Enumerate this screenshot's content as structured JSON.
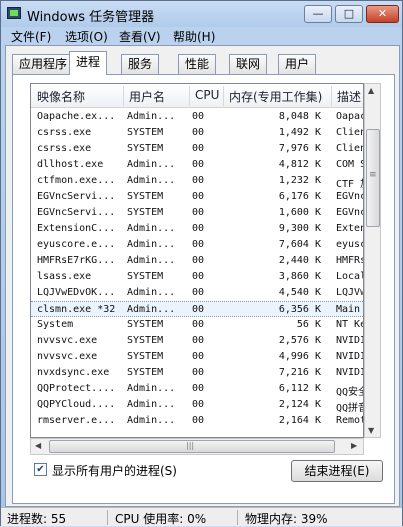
{
  "window": {
    "title": "Windows 任务管理器",
    "min_glyph": "—",
    "max_glyph": "□",
    "close_glyph": "✕"
  },
  "menu": [
    "文件(F)",
    "选项(O)",
    "查看(V)",
    "帮助(H)"
  ],
  "tabs": [
    "应用程序",
    "进程",
    "服务",
    "性能",
    "联网",
    "用户"
  ],
  "active_tab": "进程",
  "columns": {
    "name": "映像名称",
    "user": "用户名",
    "cpu": "CPU",
    "mem": "内存(专用工作集)",
    "desc": "描述"
  },
  "processes": [
    {
      "name": "Oapache.ex...",
      "user": "Admin...",
      "cpu": "00",
      "mem": "8,048 K",
      "desc": "Oapac"
    },
    {
      "name": "csrss.exe",
      "user": "SYSTEM",
      "cpu": "00",
      "mem": "1,492 K",
      "desc": "Clien"
    },
    {
      "name": "csrss.exe",
      "user": "SYSTEM",
      "cpu": "00",
      "mem": "7,976 K",
      "desc": "Clien"
    },
    {
      "name": "dllhost.exe",
      "user": "Admin...",
      "cpu": "00",
      "mem": "4,812 K",
      "desc": "COM S"
    },
    {
      "name": "ctfmon.exe...",
      "user": "Admin...",
      "cpu": "00",
      "mem": "1,232 K",
      "desc": "CTF 加"
    },
    {
      "name": "EGVncServi...",
      "user": "SYSTEM",
      "cpu": "00",
      "mem": "6,176 K",
      "desc": "EGVnc"
    },
    {
      "name": "EGVncServi...",
      "user": "SYSTEM",
      "cpu": "00",
      "mem": "1,600 K",
      "desc": "EGVnc"
    },
    {
      "name": "ExtensionC...",
      "user": "Admin...",
      "cpu": "00",
      "mem": "9,300 K",
      "desc": "Exten"
    },
    {
      "name": "eyuscore.e...",
      "user": "Admin...",
      "cpu": "00",
      "mem": "7,604 K",
      "desc": "eyusc"
    },
    {
      "name": "HMFRsE7rKG...",
      "user": "Admin...",
      "cpu": "00",
      "mem": "2,440 K",
      "desc": "HMFRs"
    },
    {
      "name": "lsass.exe",
      "user": "SYSTEM",
      "cpu": "00",
      "mem": "3,860 K",
      "desc": "Local"
    },
    {
      "name": "LQJVwEDvOK...",
      "user": "Admin...",
      "cpu": "00",
      "mem": "4,540 K",
      "desc": "LQJVw"
    },
    {
      "name": "clsmn.exe *32",
      "user": "Admin...",
      "cpu": "00",
      "mem": "6,356 K",
      "desc": "Main"
    },
    {
      "name": "System",
      "user": "SYSTEM",
      "cpu": "00",
      "mem": "56 K",
      "desc": "NT Ke"
    },
    {
      "name": "nvvsvc.exe",
      "user": "SYSTEM",
      "cpu": "00",
      "mem": "2,576 K",
      "desc": "NVIDI"
    },
    {
      "name": "nvvsvc.exe",
      "user": "SYSTEM",
      "cpu": "00",
      "mem": "4,996 K",
      "desc": "NVIDI"
    },
    {
      "name": "nvxdsync.exe",
      "user": "SYSTEM",
      "cpu": "00",
      "mem": "7,216 K",
      "desc": "NVIDI"
    },
    {
      "name": "QQProtect....",
      "user": "Admin...",
      "cpu": "00",
      "mem": "6,112 K",
      "desc": "QQ安全"
    },
    {
      "name": "QQPYCloud....",
      "user": "Admin...",
      "cpu": "00",
      "mem": "2,124 K",
      "desc": "QQ拼音"
    },
    {
      "name": "rmserver.e...",
      "user": "Admin...",
      "cpu": "00",
      "mem": "2,164 K",
      "desc": "Remot"
    }
  ],
  "selected_row": 12,
  "show_all_users": {
    "checked": true,
    "label": "显示所有用户的进程(S)",
    "check_glyph": "✔"
  },
  "end_process_label": "结束进程(E)",
  "scroll": {
    "up": "▲",
    "down": "▼",
    "left": "◀",
    "right": "▶",
    "grip": "≡",
    "hgrip": "|||"
  },
  "status": {
    "processes": "进程数: 55",
    "cpu": "CPU 使用率: 0%",
    "memory": "物理内存: 39%"
  }
}
